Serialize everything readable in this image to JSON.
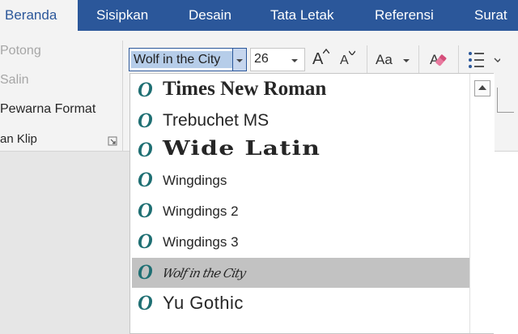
{
  "tabs": [
    {
      "label": "Beranda",
      "active": true
    },
    {
      "label": "Sisipkan"
    },
    {
      "label": "Desain"
    },
    {
      "label": "Tata Letak"
    },
    {
      "label": "Referensi"
    },
    {
      "label": "Surat"
    }
  ],
  "clipboard": {
    "cut": "Potong",
    "copy": "Salin",
    "format_painter": "Pewarna Format",
    "group_label": "an Klip"
  },
  "font": {
    "name_value": "Wolf in the City",
    "size_value": "26",
    "grow_label": "A",
    "shrink_label": "A",
    "change_case_label": "Aa"
  },
  "font_list": {
    "items": [
      {
        "label": "Times New Roman"
      },
      {
        "label": "Trebuchet MS"
      },
      {
        "label": "Wide Latin"
      },
      {
        "label": "Wingdings"
      },
      {
        "label": "Wingdings 2"
      },
      {
        "label": "Wingdings 3"
      },
      {
        "label": "Wolf in the City",
        "highlighted": true
      },
      {
        "label": "Yu Gothic"
      }
    ],
    "type_icon": "O"
  },
  "colors": {
    "ribbon_blue": "#2b579a",
    "highlight": "#c2c2c2",
    "selection": "#b6cde9",
    "opentype_icon": "#1f6f73"
  }
}
